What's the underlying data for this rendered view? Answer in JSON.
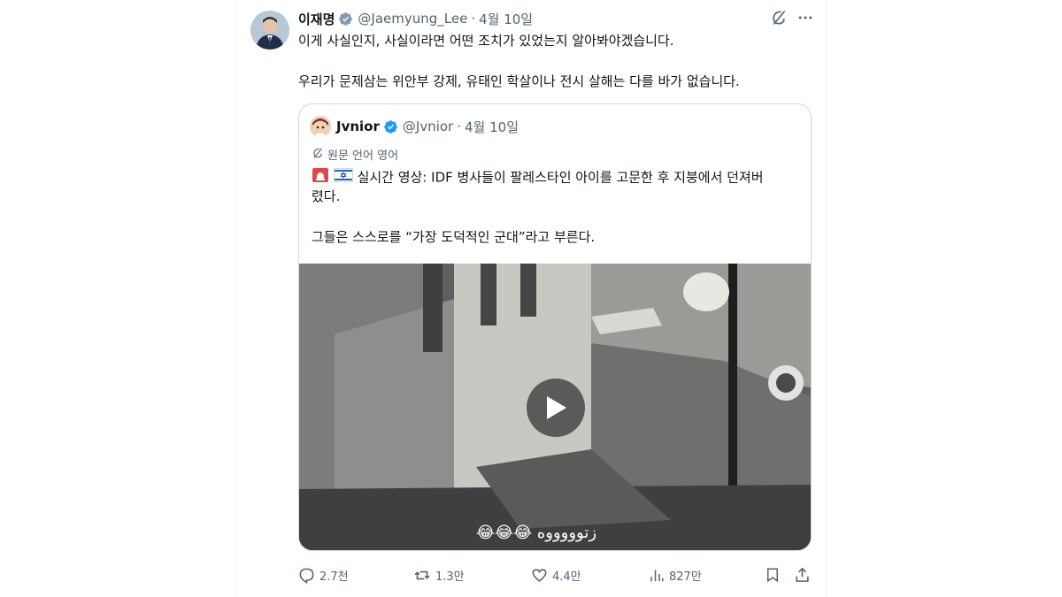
{
  "tweet": {
    "author_name": "이재명",
    "handle": "@Jaemyung_Lee",
    "separator": "·",
    "date": "4월 10일",
    "line1": "이게 사실인지, 사실이라면 어떤 조치가 있었는지 알아봐야겠습니다.",
    "line2": "우리가 문제삼는 위안부 강제, 유태인 학살이나 전시 살해는 다를 바가 없습니다."
  },
  "quote": {
    "author_name": "Jvnior",
    "handle": "@Jvnior",
    "separator": "·",
    "date": "4월 10일",
    "translate_label": "원문 언어 영어",
    "line1": "실시간 영상: IDF 병사들이 팔레스타인 아이를 고문한 후 지붕에서 던져버",
    "line2": "렸다.",
    "line3": "그들은 스스로를 “가장 도덕적인 군대”라고 부른다.",
    "media_caption": "😂😂😂 زتوووووه"
  },
  "actions": {
    "replies": "2.7천",
    "reposts": "1.3만",
    "likes": "4.4만",
    "views": "827만"
  },
  "colors": {
    "verified": "#1d9bf0",
    "muted": "#536471",
    "border": "#cfd9de"
  }
}
